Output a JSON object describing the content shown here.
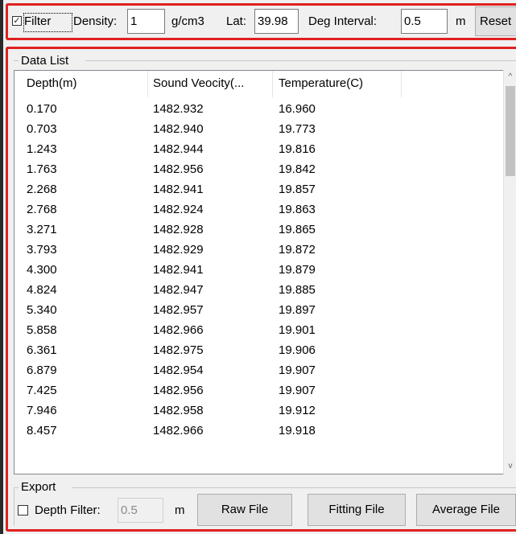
{
  "toolbar": {
    "filter_checked": true,
    "filter_label": "Filter",
    "density_label": "Density:",
    "density_value": "1",
    "density_unit": "g/cm3",
    "lat_label": "Lat:",
    "lat_value": "39.98",
    "deg_interval_label": "Deg Interval:",
    "deg_interval_value": "0.5",
    "deg_interval_unit": "m",
    "reset_label": "Reset"
  },
  "data_list": {
    "group_title": "Data List",
    "columns": [
      "Depth(m)",
      "Sound Veocity(...",
      "Temperature(C)"
    ],
    "rows": [
      [
        "0.170",
        "1482.932",
        "16.960"
      ],
      [
        "0.703",
        "1482.940",
        "19.773"
      ],
      [
        "1.243",
        "1482.944",
        "19.816"
      ],
      [
        "1.763",
        "1482.956",
        "19.842"
      ],
      [
        "2.268",
        "1482.941",
        "19.857"
      ],
      [
        "2.768",
        "1482.924",
        "19.863"
      ],
      [
        "3.271",
        "1482.928",
        "19.865"
      ],
      [
        "3.793",
        "1482.929",
        "19.872"
      ],
      [
        "4.300",
        "1482.941",
        "19.879"
      ],
      [
        "4.824",
        "1482.947",
        "19.885"
      ],
      [
        "5.340",
        "1482.957",
        "19.897"
      ],
      [
        "5.858",
        "1482.966",
        "19.901"
      ],
      [
        "6.361",
        "1482.975",
        "19.906"
      ],
      [
        "6.879",
        "1482.954",
        "19.907"
      ],
      [
        "7.425",
        "1482.956",
        "19.907"
      ],
      [
        "7.946",
        "1482.958",
        "19.912"
      ],
      [
        "8.457",
        "1482.966",
        "19.918"
      ]
    ],
    "scroll_up_icon": "^",
    "scroll_down_icon": "v"
  },
  "export": {
    "group_title": "Export",
    "depth_filter_checked": false,
    "depth_filter_label": "Depth Filter:",
    "depth_filter_value": "0.5",
    "depth_filter_unit": "m",
    "raw_file_label": "Raw File",
    "fitting_file_label": "Fitting File",
    "average_file_label": "Average File"
  }
}
